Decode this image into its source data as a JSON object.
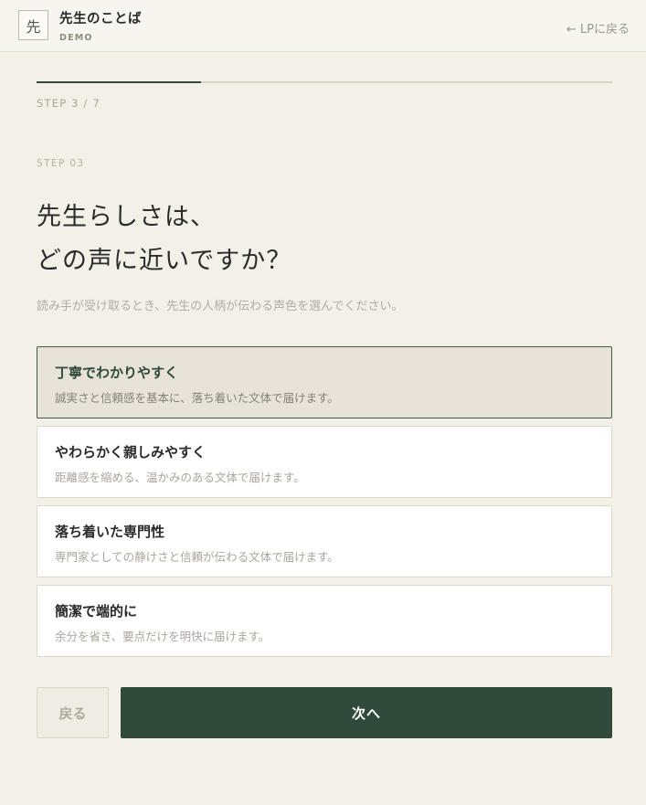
{
  "header": {
    "logo_char": "先",
    "app_name": "先生のことば",
    "tag": "DEMO",
    "back_link": "← LPに戻る"
  },
  "progress": {
    "current": 3,
    "total": 7,
    "label": "STEP 3 / 7",
    "fill_fraction": 0.286
  },
  "step": {
    "label": "STEP 03",
    "question_line1": "先生らしさは、",
    "question_line2": "どの声に近いですか？",
    "description": "読み手が受け取るとき、先生の人柄が伝わる声色を選んでください。"
  },
  "options": [
    {
      "title": "丁寧でわかりやすく",
      "desc": "誠実さと信頼感を基本に、落ち着いた文体で届けます。",
      "selected": true
    },
    {
      "title": "やわらかく親しみやすく",
      "desc": "距離感を縮める、温かみのある文体で届けます。",
      "selected": false
    },
    {
      "title": "落ち着いた専門性",
      "desc": "専門家としての静けさと信頼が伝わる文体で届けます。",
      "selected": false
    },
    {
      "title": "簡潔で端的に",
      "desc": "余分を省き、要点だけを明快に届けます。",
      "selected": false
    }
  ],
  "buttons": {
    "back": "戻る",
    "next": "次へ"
  },
  "colors": {
    "accent": "#304b3b",
    "background": "#f3f0e8",
    "selected_bg": "#e7e3d8"
  }
}
